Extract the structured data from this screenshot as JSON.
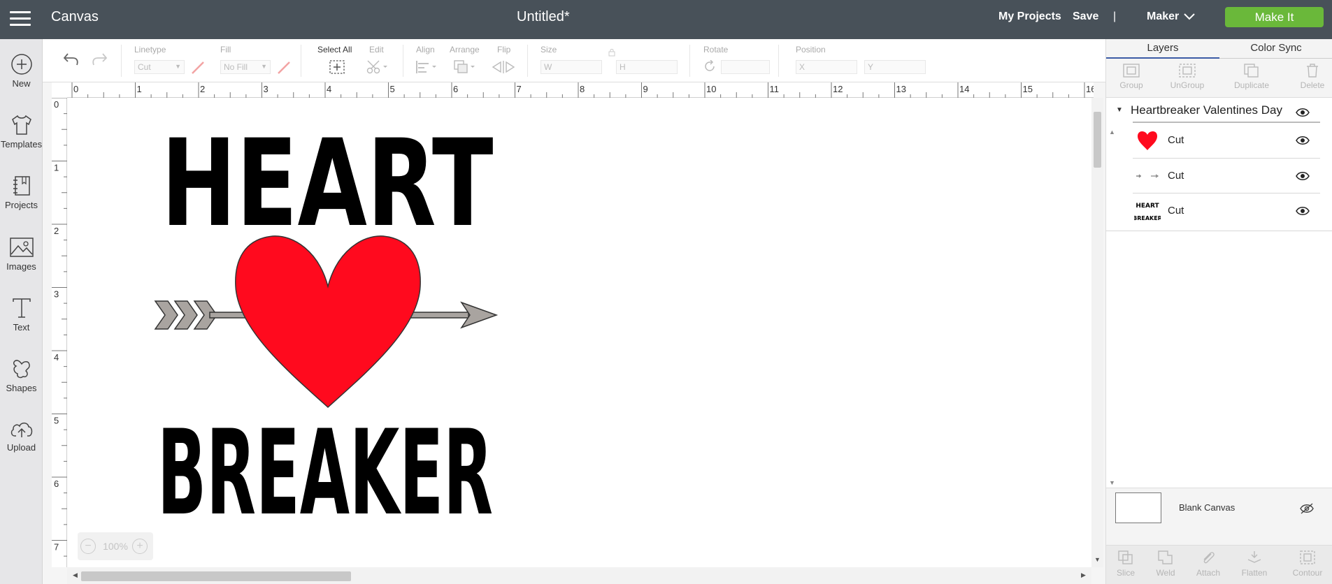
{
  "app": {
    "title": "Canvas",
    "document_title": "Untitled*"
  },
  "topbar": {
    "my_projects": "My Projects",
    "save": "Save",
    "divider": "|",
    "machine": "Maker",
    "make_it": "Make It"
  },
  "sidebar": {
    "items": [
      {
        "label": "New",
        "icon": "plus-circle-icon"
      },
      {
        "label": "Templates",
        "icon": "tshirt-icon"
      },
      {
        "label": "Projects",
        "icon": "notebook-icon"
      },
      {
        "label": "Images",
        "icon": "image-icon"
      },
      {
        "label": "Text",
        "icon": "text-icon"
      },
      {
        "label": "Shapes",
        "icon": "shapes-icon"
      },
      {
        "label": "Upload",
        "icon": "cloud-upload-icon"
      }
    ]
  },
  "toolbar": {
    "linetype_label": "Linetype",
    "linetype_value": "Cut",
    "fill_label": "Fill",
    "fill_value": "No Fill",
    "select_all": "Select All",
    "edit": "Edit",
    "align": "Align",
    "arrange": "Arrange",
    "flip": "Flip",
    "size": "Size",
    "w": "W",
    "h": "H",
    "rotate": "Rotate",
    "position": "Position",
    "x": "X",
    "y": "Y"
  },
  "ruler": {
    "top": [
      "0",
      "1",
      "2",
      "3",
      "4",
      "5",
      "6",
      "7",
      "8",
      "9",
      "10",
      "11",
      "12",
      "13",
      "14",
      "15",
      "16"
    ],
    "left": [
      "0",
      "1",
      "2",
      "3",
      "4",
      "5",
      "6",
      "7"
    ]
  },
  "canvas": {
    "top_word": "HEART",
    "bottom_word": "BREAKER",
    "heart_color": "#ff0a1e",
    "arrow_color": "#a9a4a0"
  },
  "zoom": {
    "minus": "−",
    "value": "100%",
    "plus": "+"
  },
  "panel": {
    "tabs": [
      "Layers",
      "Color Sync"
    ],
    "tools": [
      "Group",
      "UnGroup",
      "Duplicate",
      "Delete"
    ],
    "group_name": "Heartbreaker Valentines Day",
    "layers": [
      {
        "name": "Cut",
        "thumb": "heart"
      },
      {
        "name": "Cut",
        "thumb": "arrow"
      },
      {
        "name": "Cut",
        "thumb": "text",
        "thumb_text_1": "HEART",
        "thumb_text_2": "BREAKER"
      }
    ],
    "blank_canvas": "Blank Canvas",
    "bottom_tools": [
      "Slice",
      "Weld",
      "Attach",
      "Flatten",
      "Contour"
    ]
  }
}
